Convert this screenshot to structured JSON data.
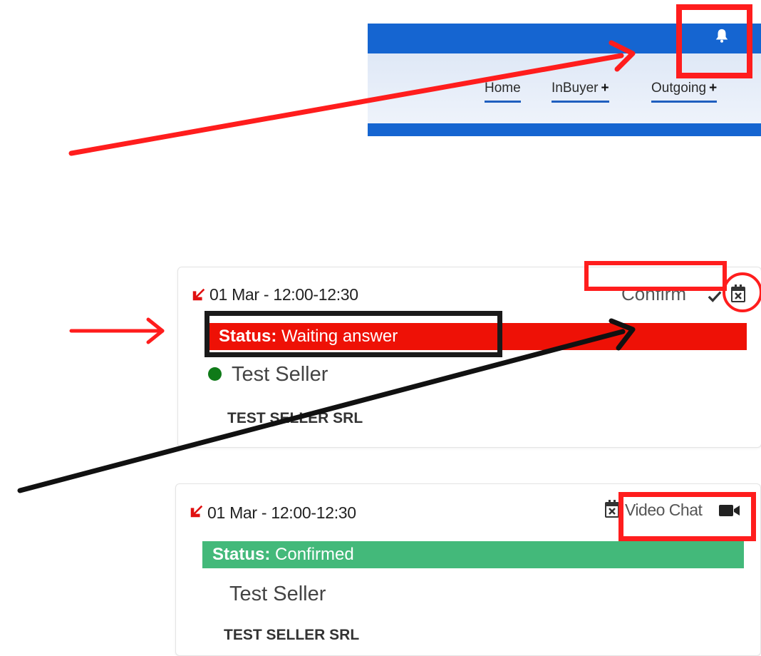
{
  "navbar": {
    "links": [
      {
        "label": "Home",
        "plus": ""
      },
      {
        "label": "InBuyer",
        "plus": "+"
      },
      {
        "label": "Outgoing",
        "plus": "+"
      }
    ],
    "colors": {
      "bar": "#1565d1",
      "underline": "#1f5fbf"
    },
    "bell_icon": "bell-icon"
  },
  "appointments": [
    {
      "time": "01 Mar - 12:00-12:30",
      "status_label": "Status:",
      "status_value": "Waiting answer",
      "status_color": "#ee1106",
      "seller": "Test Seller",
      "online_dot_color": "#0f7a18",
      "company": "TEST SELLER SRL",
      "action_label": "Confirm",
      "action_icon": "check-icon",
      "secondary_icon": "calendar-x-icon"
    },
    {
      "time": "01 Mar - 12:00-12:30",
      "status_label": "Status:",
      "status_value": "Confirmed",
      "status_color": "#43b97a",
      "seller": "Test Seller",
      "company": "TEST SELLER SRL",
      "action_label": "Video Chat",
      "action_icon": "video-camera-icon",
      "secondary_icon": "calendar-x-icon"
    }
  ],
  "annotation_colors": {
    "red": "#ff1d1d",
    "black": "#111111"
  }
}
